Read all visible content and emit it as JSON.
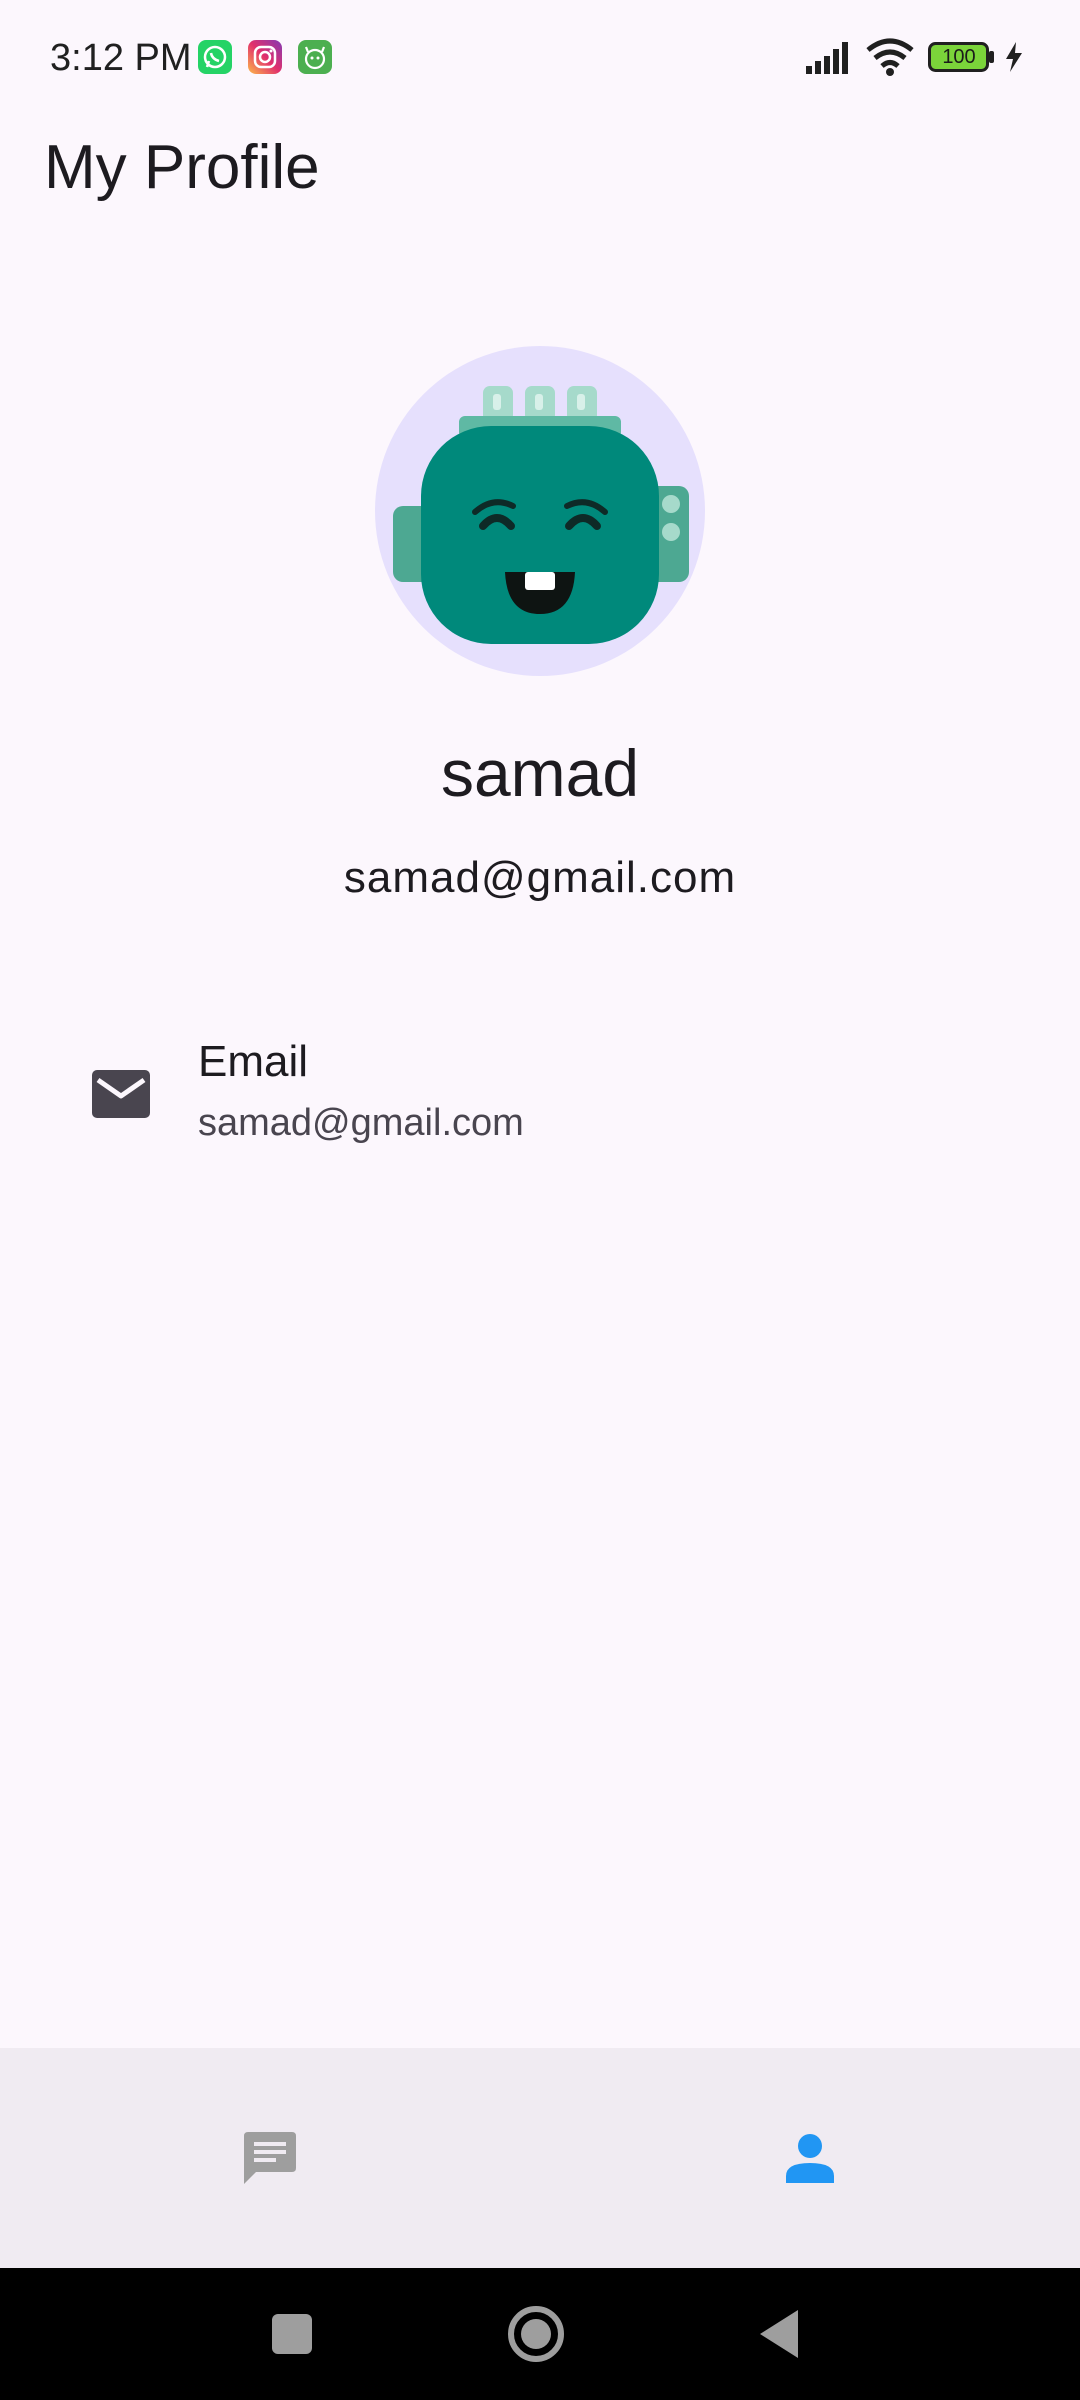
{
  "status_bar": {
    "time": "3:12 PM",
    "notification_icons": [
      "whatsapp-icon",
      "instagram-icon",
      "app-notification-icon"
    ],
    "battery": "100",
    "colors": {
      "whatsapp": "#25D366",
      "instagram": "#C13584",
      "app": "#4CAF50",
      "battery_fill": "#7BD43A"
    }
  },
  "app_bar": {
    "title": "My Profile"
  },
  "profile": {
    "avatar_icon": "robot-avatar-icon",
    "name": "samad",
    "email": "samad@gmail.com"
  },
  "details": [
    {
      "icon": "email-icon",
      "title": "Email",
      "value": "samad@gmail.com"
    }
  ],
  "bottom_nav": {
    "items": [
      {
        "icon": "chat-icon",
        "selected": false
      },
      {
        "icon": "person-icon",
        "selected": true
      }
    ],
    "colors": {
      "selected": "#2196F3",
      "unselected": "#9E9E9E",
      "background": "#F0EBF2"
    }
  },
  "system_nav": {
    "buttons": [
      "recents-button",
      "home-button",
      "back-button"
    ]
  },
  "theme": {
    "background": "#FCF7FD",
    "avatar_background": "#E6E0FD",
    "robot_color": "#00897B"
  }
}
